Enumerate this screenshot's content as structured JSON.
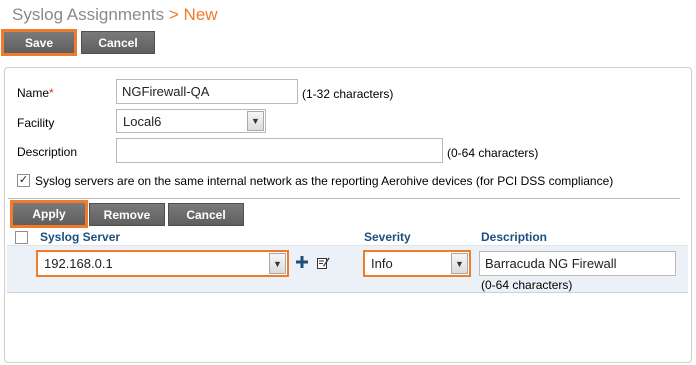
{
  "header": {
    "title": "Syslog Assignments",
    "separator": ">",
    "current": "New"
  },
  "toolbar": {
    "save_label": "Save",
    "cancel_label": "Cancel"
  },
  "form": {
    "name": {
      "label": "Name",
      "required_mark": "*",
      "value": "NGFirewall-QA",
      "hint": "(1-32 characters)"
    },
    "facility": {
      "label": "Facility",
      "selected": "Local6"
    },
    "description": {
      "label": "Description",
      "value": "",
      "hint": "(0-64 characters)"
    },
    "same_network": {
      "checked": true,
      "label": "Syslog servers are on the same internal network as the reporting Aerohive devices (for PCI DSS compliance)"
    }
  },
  "server_toolbar": {
    "apply_label": "Apply",
    "remove_label": "Remove",
    "cancel_label": "Cancel"
  },
  "table": {
    "columns": {
      "server": "Syslog Server",
      "severity": "Severity",
      "description": "Description"
    },
    "row": {
      "server": "192.168.0.1",
      "severity": "Info",
      "description": "Barracuda NG Firewall",
      "description_hint": "(0-64 characters)"
    }
  },
  "colors": {
    "accent": "#f07b2a",
    "button": "#6a6a6a",
    "header_text": "#1d4f7f",
    "row_bg": "#ecf1f8"
  }
}
